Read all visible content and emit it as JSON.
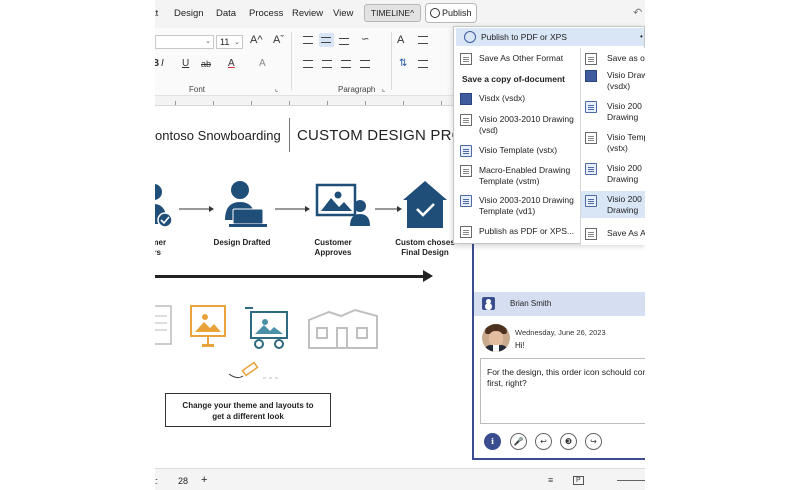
{
  "menu": {
    "items": [
      "tt",
      "Design",
      "Data",
      "Process",
      "Review",
      "View"
    ],
    "timeline_label": "TIMELINE",
    "timeline_caret": "^",
    "publish_label": "Publish",
    "share_glyph": "↶"
  },
  "ribbon": {
    "font_size": "11",
    "caret": "⌄",
    "font_group_label": "Font",
    "paragraph_group_label": "Paragraph",
    "buttons": {
      "grow_font": "A^",
      "shrink_font": "Aˇ",
      "clear": "A⃠",
      "bold": "B",
      "italic": "I",
      "underline": "U",
      "strikethrough": "ab",
      "font_color": "A",
      "highlight": "A",
      "text_direction": "A",
      "line_spacing": "⇅",
      "launcher": "⌞"
    }
  },
  "canvas": {
    "title_left": "ontoso Snowboarding",
    "title_right": "CUSTOM DESIGN PROC",
    "steps": [
      {
        "line1": "tomer",
        "line2": "ers"
      },
      {
        "line1": "Design Drafted",
        "line2": ""
      },
      {
        "line1": "Customer",
        "line2": "Approves"
      },
      {
        "line1": "Custom choses",
        "line2": "Final Design"
      }
    ],
    "theme_line1": "Change your theme and layouts to",
    "theme_line2": "get a different look"
  },
  "export_menu": {
    "publish_pdf": "Publish to PDF or XPS",
    "save_other": "Save As Other Format",
    "heading": "Save a copy of-document",
    "items": [
      {
        "line1": "Visdx (vsdx)",
        "line2": ""
      },
      {
        "line1": "Visio 2003-2010 Drawing",
        "line2": "(vsd)"
      },
      {
        "line1": "Visio Template (vstx)",
        "line2": ""
      },
      {
        "line1": "Macro-Enabled Drawing",
        "line2": "Template (vstm)"
      },
      {
        "line1": "Visio 2003-2010 Drawing",
        "line2": "Template (vd1)"
      },
      {
        "line1": "Publish as PDF or XPS...",
        "line2": ""
      }
    ],
    "more_glyph": "•",
    "submenu": [
      {
        "line1": "Save as o",
        "line2": ""
      },
      {
        "line1": "Visio Draw",
        "line2": "(vsdx)"
      },
      {
        "line1": "Visio 200",
        "line2": "Drawing"
      },
      {
        "line1": "Visio Temp",
        "line2": "(vstx)"
      },
      {
        "line1": "Visio 200",
        "line2": "Drawing"
      },
      {
        "line1": "Visio 200",
        "line2": "Drawing"
      },
      {
        "line1": "Save As A",
        "line2": ""
      }
    ]
  },
  "comment_panel": {
    "user": "Brian Smith",
    "date": "Wednesday, June 26, 2023",
    "greeting": "Hi!",
    "reply": "For the design, this order icon schould con\nfirst, right?",
    "buttons": [
      "ℹ",
      "🎤",
      "↩",
      "❸",
      "↪"
    ]
  },
  "status": {
    "left_text": "t:",
    "page_count": "28",
    "add_glyph": "+",
    "icon_one": "≡",
    "icon_two": "P"
  },
  "colors": {
    "brand": "#1f4e79",
    "accent": "#e8a33a",
    "panel": "#3a4e8f"
  }
}
